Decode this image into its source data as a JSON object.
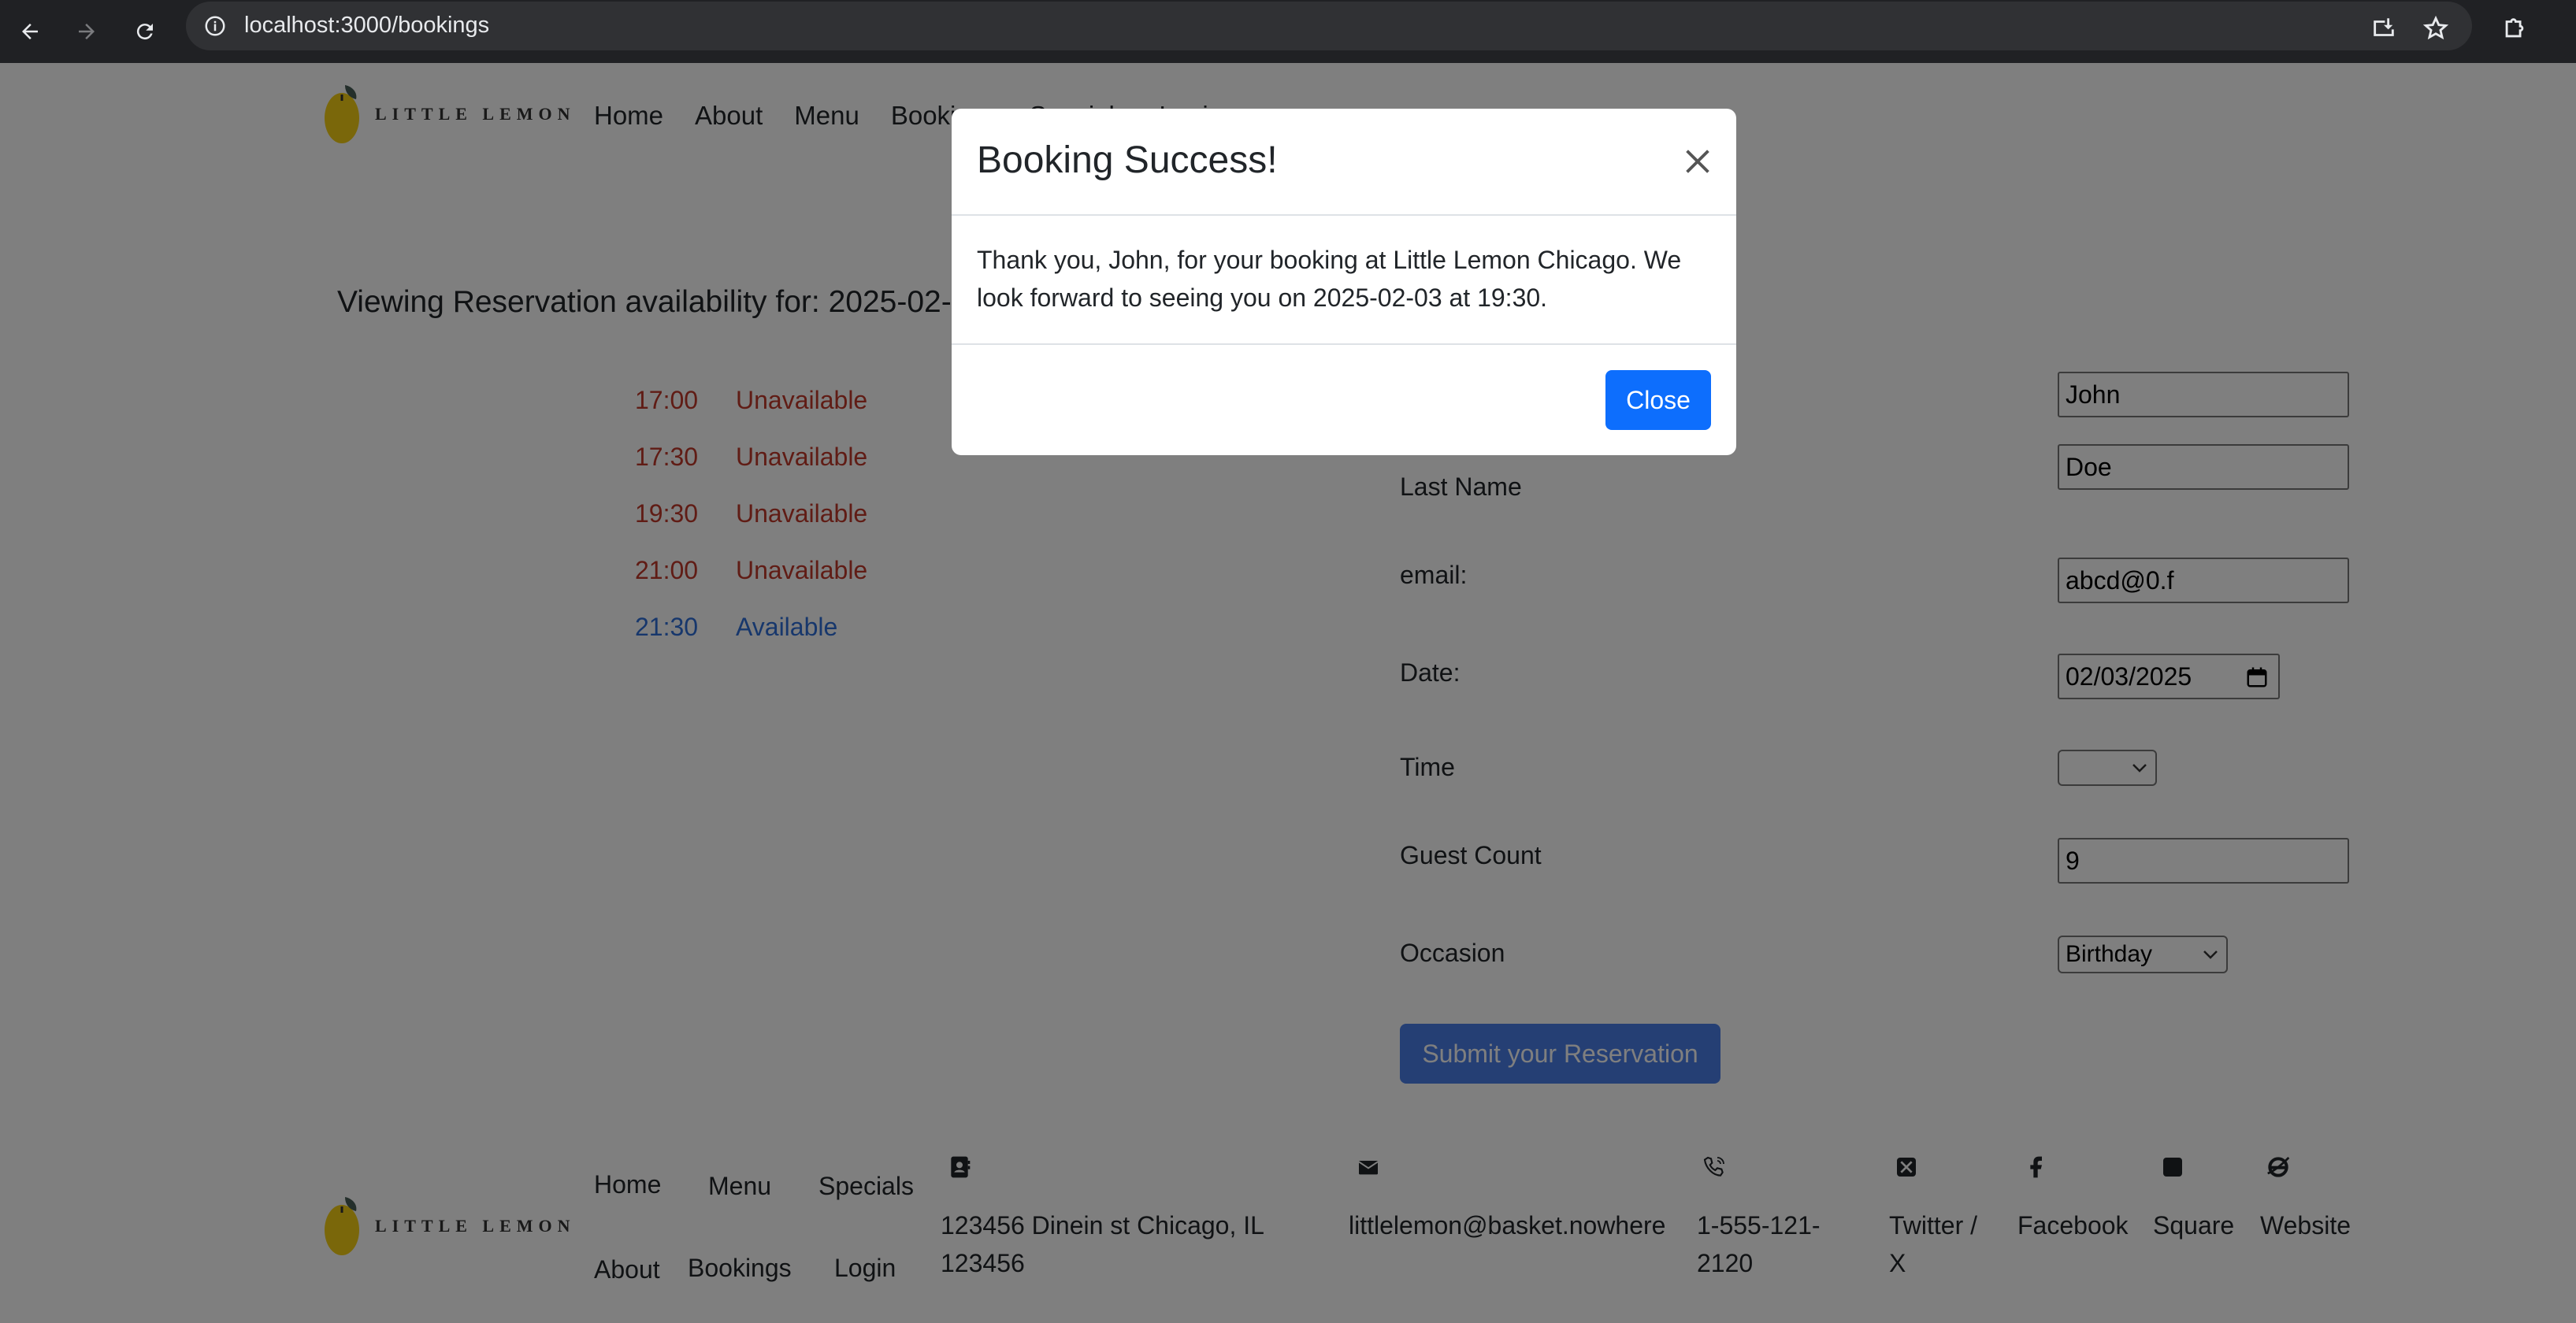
{
  "browser": {
    "url": "localhost:3000/bookings"
  },
  "header": {
    "logo_text": "LITTLE LEMON",
    "nav": [
      "Home",
      "About",
      "Menu",
      "Bookings",
      "Specials",
      "Login"
    ]
  },
  "availability": {
    "title": "Viewing Reservation availability for: 2025-02-03",
    "slots": [
      {
        "time": "17:00",
        "status": "Unavailable"
      },
      {
        "time": "17:30",
        "status": "Unavailable"
      },
      {
        "time": "19:30",
        "status": "Unavailable"
      },
      {
        "time": "21:00",
        "status": "Unavailable"
      },
      {
        "time": "21:30",
        "status": "Available"
      }
    ]
  },
  "form": {
    "first_name_value": "John",
    "last_name_label": "Last Name",
    "last_name_value": "Doe",
    "email_label": "email:",
    "email_value": "abcd@0.f",
    "date_label": "Date:",
    "date_value": "02/03/2025",
    "time_label": "Time",
    "time_value": "",
    "guest_label": "Guest Count",
    "guest_value": "9",
    "occasion_label": "Occasion",
    "occasion_value": "Birthday",
    "submit_label": "Submit your Reservation"
  },
  "footer": {
    "logo_text": "LITTLE LEMON",
    "nav": [
      "Home",
      "Menu",
      "Specials",
      "About",
      "Bookings",
      "Login"
    ],
    "address_lines": [
      "123456 Dinein st Chicago, IL",
      "123456"
    ],
    "email": "littlelemon@basket.nowhere",
    "phone_lines": [
      "1-555-121-",
      "2120"
    ],
    "socials": [
      "Twitter /",
      "X",
      "Facebook",
      "Square",
      "Website"
    ]
  },
  "modal": {
    "title": "Booking Success!",
    "body": "Thank you, John, for your booking at Little Lemon Chicago. We look forward to seeing you on 2025-02-03 at 19:30.",
    "close_label": "Close"
  },
  "colors": {
    "unavailable": "#c0392b",
    "available": "#2f6fd8",
    "primary": "#0d6efd"
  }
}
